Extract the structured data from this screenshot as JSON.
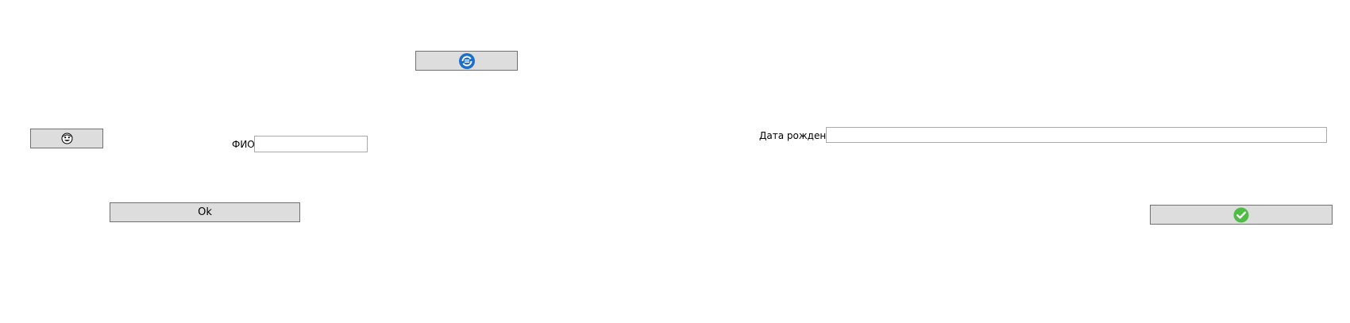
{
  "form": {
    "fio_label": "ФИО",
    "fio_value": "",
    "dob_label": "Дата рождения",
    "dob_value": "",
    "ok_label": "Ok"
  },
  "icons": {
    "refresh_button_icon": "refresh-cloud-icon",
    "face_button_icon": "face-icon",
    "confirm_button_icon": "check-circle-icon"
  },
  "colors": {
    "refresh_icon": "#1d6fc9",
    "check_icon": "#4fbd43",
    "button_bg": "#dddddd",
    "button_border": "#707070"
  }
}
